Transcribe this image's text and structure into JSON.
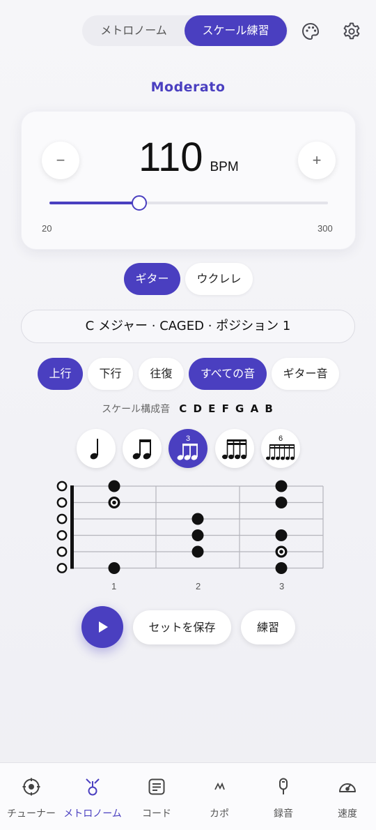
{
  "header": {
    "tabs": [
      {
        "label": "メトロノーム",
        "active": false
      },
      {
        "label": "スケール練習",
        "active": true
      }
    ],
    "icons": [
      "palette-icon",
      "gear-icon"
    ]
  },
  "tempo": {
    "name": "Moderato",
    "bpm": "110",
    "unit": "BPM",
    "minus_label": "−",
    "plus_label": "+",
    "min": "20",
    "max": "300",
    "slider_value": 110
  },
  "instrument": {
    "options": [
      {
        "label": "ギター",
        "active": true
      },
      {
        "label": "ウクレレ",
        "active": false
      }
    ]
  },
  "scale": {
    "selector": "C メジャー · CAGED · ポジション 1",
    "directions": [
      {
        "label": "上行",
        "active": true
      },
      {
        "label": "下行",
        "active": false
      },
      {
        "label": "往復",
        "active": false
      },
      {
        "label": "すべての音",
        "active": true
      },
      {
        "label": "ギター音",
        "active": false
      }
    ],
    "notes_label": "スケール構成音",
    "notes_value": "C D E F G A B"
  },
  "rhythm": {
    "options": [
      {
        "name": "quarter-note-icon",
        "active": false
      },
      {
        "name": "eighth-notes-icon",
        "active": false
      },
      {
        "name": "triplet-icon",
        "active": true,
        "tuplet": "3"
      },
      {
        "name": "sixteenth-notes-icon",
        "active": false
      },
      {
        "name": "sextuplet-icon",
        "active": false,
        "tuplet": "6"
      }
    ]
  },
  "fretboard": {
    "fret_numbers": [
      "1",
      "2",
      "3"
    ],
    "open_strings": [
      1,
      2,
      3,
      4,
      5,
      6
    ],
    "notes": [
      {
        "string": 1,
        "fret": 1,
        "root": false
      },
      {
        "string": 1,
        "fret": 3,
        "root": false
      },
      {
        "string": 2,
        "fret": 1,
        "root": true
      },
      {
        "string": 2,
        "fret": 3,
        "root": false
      },
      {
        "string": 3,
        "fret": 2,
        "root": false
      },
      {
        "string": 4,
        "fret": 2,
        "root": false
      },
      {
        "string": 4,
        "fret": 3,
        "root": false
      },
      {
        "string": 5,
        "fret": 2,
        "root": false
      },
      {
        "string": 5,
        "fret": 3,
        "root": true
      },
      {
        "string": 6,
        "fret": 1,
        "root": false
      },
      {
        "string": 6,
        "fret": 3,
        "root": false
      }
    ]
  },
  "actions": {
    "save": "セットを保存",
    "practice": "練習"
  },
  "bottom_nav": [
    {
      "label": "チューナー",
      "icon": "tuner-icon",
      "active": false
    },
    {
      "label": "メトロノーム",
      "icon": "metronome-icon",
      "active": true
    },
    {
      "label": "コード",
      "icon": "chord-icon",
      "active": false
    },
    {
      "label": "カポ",
      "icon": "capo-icon",
      "active": false
    },
    {
      "label": "録音",
      "icon": "microphone-icon",
      "active": false
    },
    {
      "label": "速度",
      "icon": "speedometer-icon",
      "active": false
    }
  ],
  "colors": {
    "accent": "#4a3fc0",
    "background": "#f3f3f7"
  }
}
